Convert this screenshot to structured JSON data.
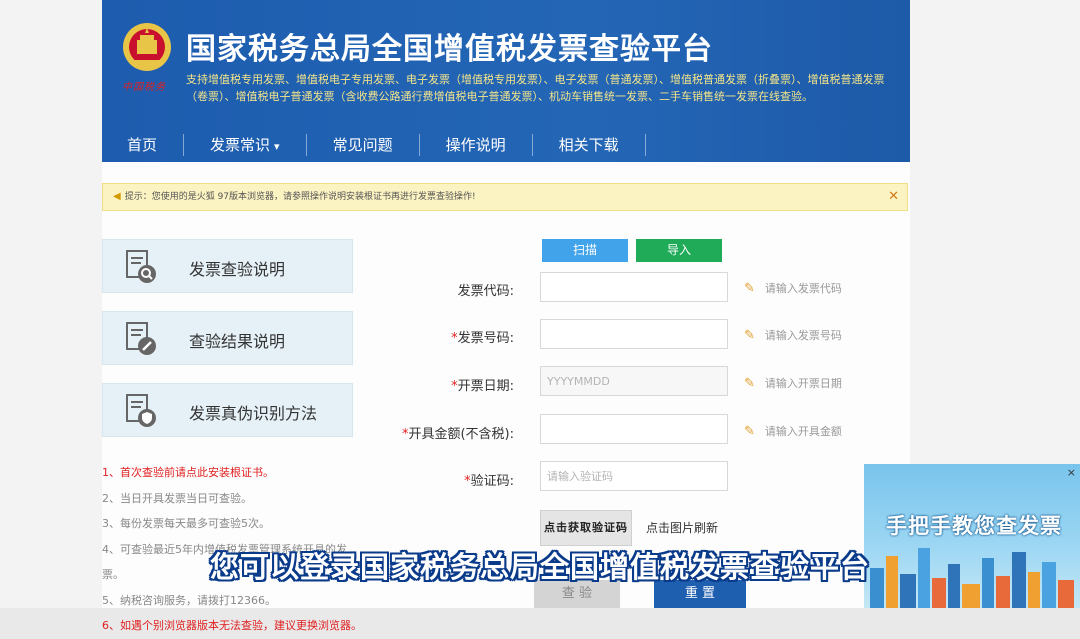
{
  "header": {
    "title": "国家税务总局全国增值税发票查验平台",
    "emblem_caption": "中国税务",
    "subtitle": "支持增值税专用发票、增值税电子专用发票、电子发票（增值税专用发票）、电子发票（普通发票）、增值税普通发票（折叠票）、增值税普通发票（卷票）、增值税电子普通发票（含收费公路通行费增值税电子普通发票）、机动车销售统一发票、二手车销售统一发票在线查验。"
  },
  "nav": {
    "items": [
      "首页",
      "发票常识",
      "常见问题",
      "操作说明",
      "相关下载"
    ]
  },
  "notice": {
    "text": "提示：您使用的是火狐 97版本浏览器，请参照操作说明安装根证书再进行发票查验操作!",
    "close": "✕"
  },
  "sidebar": {
    "cards": [
      "发票查验说明",
      "查验结果说明",
      "发票真伪识别方法"
    ]
  },
  "tips": [
    "1、首次查验前请点此安装根证书。",
    "2、当日开具发票当日可查验。",
    "3、每份发票每天最多可查验5次。",
    "4、可查验最近5年内增值税发票管理系统开具的发票。",
    "5、纳税咨询服务，请拨打12366。",
    "6、如遇个别浏览器版本无法查验，建议更换浏览器。"
  ],
  "form": {
    "scan_label": "扫描",
    "import_label": "导入",
    "code_label": "发票代码:",
    "code_hint": "请输入发票代码",
    "number_label": "发票号码:",
    "number_hint": "请输入发票号码",
    "date_label": "开票日期:",
    "date_placeholder": "YYYYMMDD",
    "date_hint": "请输入开票日期",
    "amount_label": "开具金额(不含税):",
    "amount_hint": "请输入开具金额",
    "captcha_label": "验证码:",
    "captcha_placeholder": "请输入验证码",
    "captcha_image_text": "点击获取验证码",
    "captcha_refresh": "点击图片刷新",
    "check_label": "查 验",
    "reset_label": "重 置",
    "required_mark": "*"
  },
  "promo": {
    "title": "手把手教您查发票",
    "close": "×"
  },
  "video_caption": "您可以登录国家税务总局全国增值税发票查验平台",
  "colors": {
    "header_blue": "#1f5fb0",
    "scan_blue": "#41a3ea",
    "import_green": "#1fab58",
    "notice_bg": "#fcf3c2",
    "required_red": "#e02020"
  }
}
